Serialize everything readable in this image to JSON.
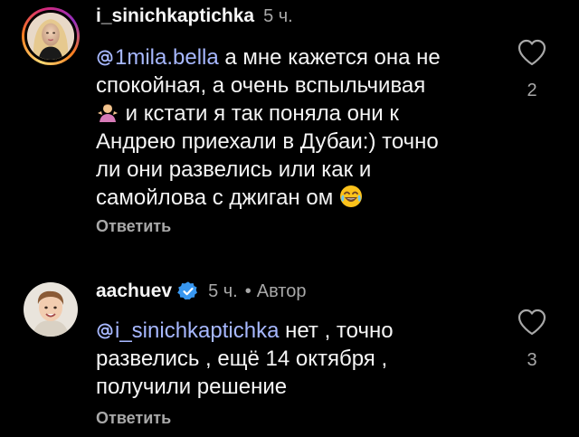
{
  "comments": [
    {
      "username": "i_sinichkaptichka",
      "time": "5 ч.",
      "mention": "1mila.bella",
      "lines_after_mention_first": " а мне кажется она не",
      "lines": [
        "спокойная, а очень вспыльчивая",
        " и кстати я так поняла они к",
        "Андрею приехали в Дубаи:) точно",
        "ли они развелись  или как и",
        "самойлова с джиган ом "
      ],
      "emojis": [
        "person-shrugging-emoji",
        "face-with-tears-of-joy-emoji"
      ],
      "reply_label": "Ответить",
      "like_count": "2"
    },
    {
      "username": "aachuev",
      "verified": true,
      "time": "5 ч.",
      "separator": "•",
      "author_badge": "Автор",
      "mention": "i_sinichkaptichka",
      "lines_after_mention_first": " нет , точно",
      "lines": [
        "развелись , ещё 14 октября ,",
        "получили решение"
      ],
      "reply_label": "Ответить",
      "like_count": "3"
    }
  ],
  "colors": {
    "background": "#000000",
    "text": "#f5f5f5",
    "secondary": "#a8a8a8",
    "mention": "#a7b8ff",
    "verified": "#3897f0"
  },
  "icons": {
    "like": "heart-outline-icon",
    "mention": "at-sign-icon",
    "verified": "verified-badge-icon"
  }
}
